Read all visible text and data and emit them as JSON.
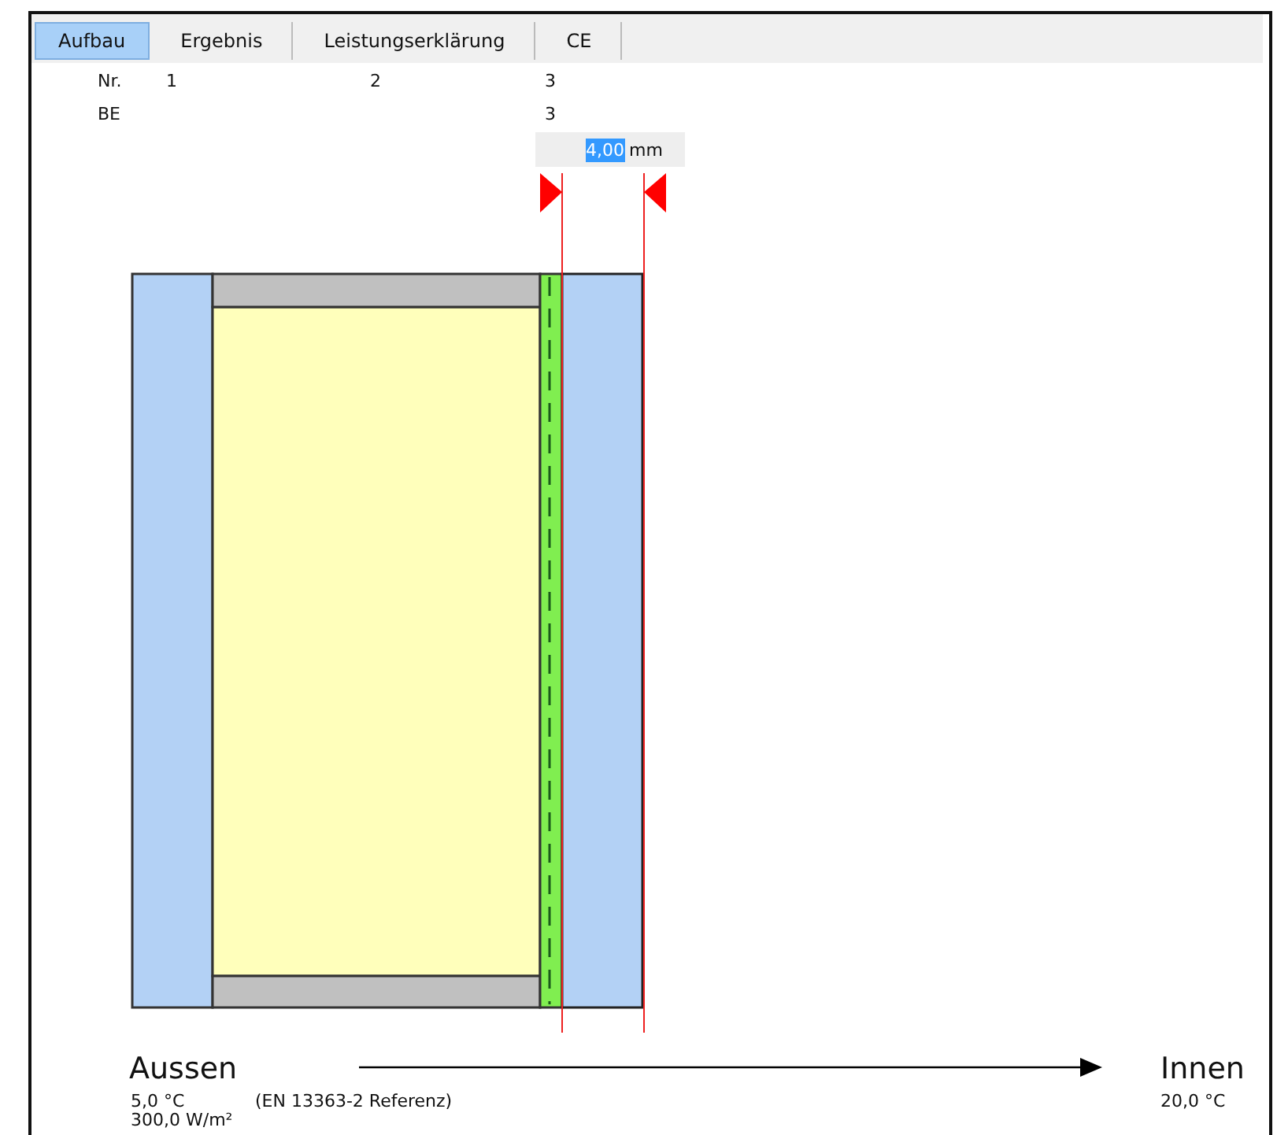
{
  "tabs": [
    {
      "label": "Aufbau",
      "selected": true
    },
    {
      "label": "Ergebnis",
      "selected": false
    },
    {
      "label": "Leistungserklärung",
      "selected": false
    },
    {
      "label": "CE",
      "selected": false
    }
  ],
  "row_labels": {
    "nr": "Nr.",
    "be": "BE"
  },
  "layers": [
    {
      "kind": "glass",
      "nr": "1",
      "selected": false
    },
    {
      "kind": "cavity",
      "nr": "2",
      "selected": false
    },
    {
      "kind": "film",
      "nr": "3",
      "be": "3",
      "selected": false
    },
    {
      "kind": "glass",
      "selected": true
    }
  ],
  "thickness_field": {
    "value": "4,00",
    "unit": "mm",
    "highlighted": true
  },
  "outside": {
    "label": "Aussen",
    "temperature": "5,0 °C",
    "radiation": "300,0 W/m²",
    "reference": "(EN 13363-2 Referenz)"
  },
  "inside": {
    "label": "Innen",
    "temperature": "20,0 °C"
  }
}
